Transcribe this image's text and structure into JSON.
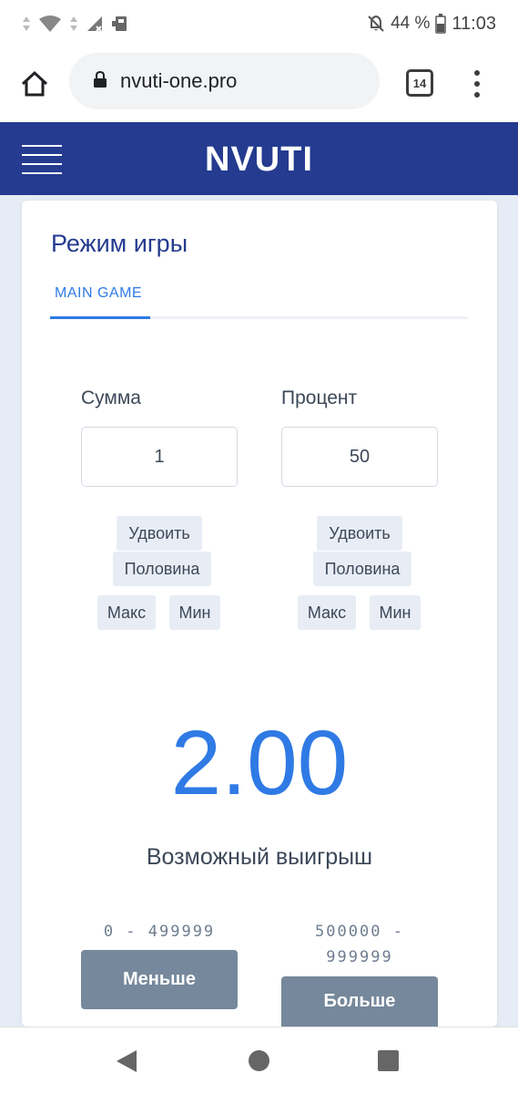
{
  "status_bar": {
    "battery_percent": "44 %",
    "time": "11:03"
  },
  "browser": {
    "url": "nvuti-one.pro",
    "tab_count": "14"
  },
  "site": {
    "title": "NVUTI"
  },
  "card": {
    "title": "Режим игры",
    "tab_label": "MAIN GAME"
  },
  "sum": {
    "label": "Сумма",
    "value": "1",
    "buttons": {
      "double": "Удвоить",
      "half": "Половина",
      "max": "Макс",
      "min": "Мин"
    }
  },
  "percent": {
    "label": "Процент",
    "value": "50",
    "buttons": {
      "double": "Удвоить",
      "half": "Половина",
      "max": "Макс",
      "min": "Мин"
    }
  },
  "result": {
    "multiplier": "2.00",
    "label": "Возможный выигрыш"
  },
  "bets": {
    "lower_range": "0 - 499999",
    "lower_label": "Меньше",
    "higher_range_line1": "500000 -",
    "higher_range_line2": "999999",
    "higher_label": "Больше"
  },
  "colors": {
    "header": "#243b8f",
    "accent": "#2f7ae5",
    "bet_button": "#76889b",
    "page_background": "#e6ecf5"
  }
}
